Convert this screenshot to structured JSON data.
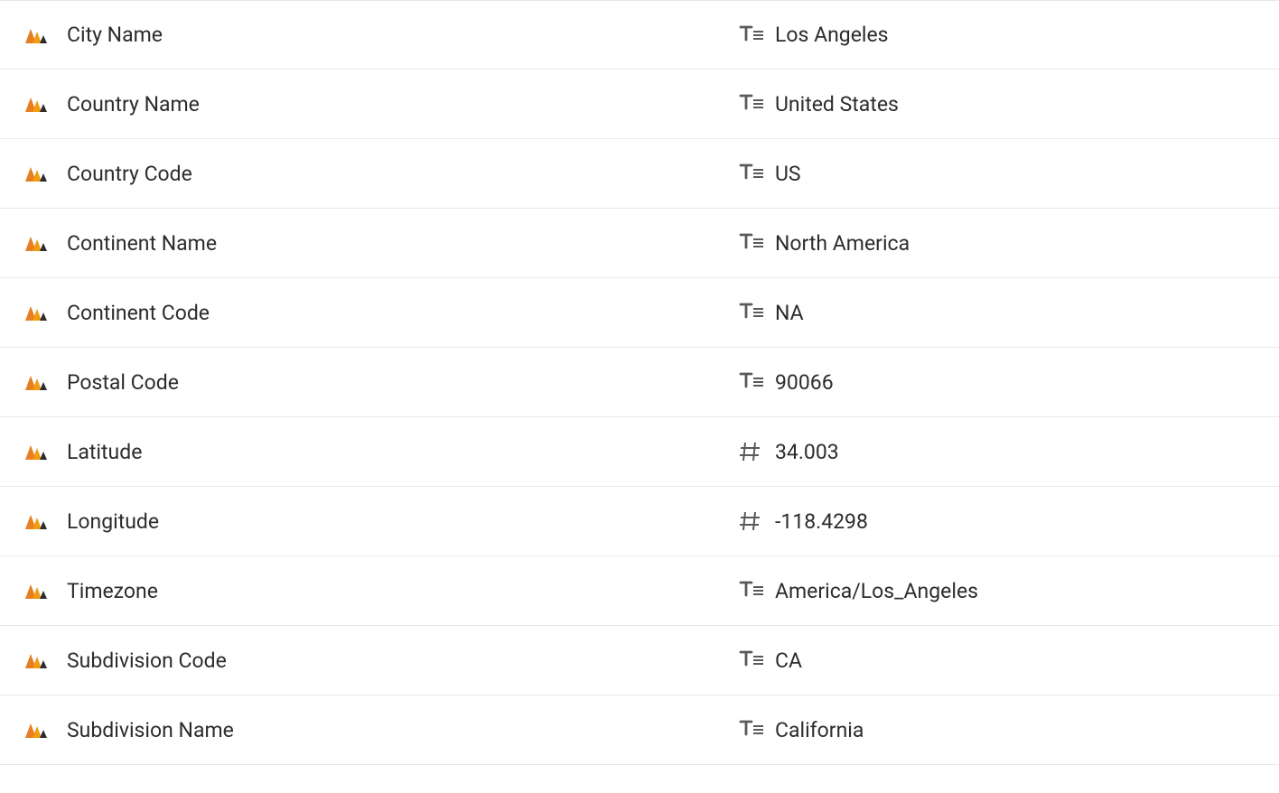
{
  "rows": [
    {
      "label": "City Name",
      "value": "Los Angeles",
      "type": "text"
    },
    {
      "label": "Country Name",
      "value": "United States",
      "type": "text"
    },
    {
      "label": "Country Code",
      "value": "US",
      "type": "text"
    },
    {
      "label": "Continent Name",
      "value": "North America",
      "type": "text"
    },
    {
      "label": "Continent Code",
      "value": "NA",
      "type": "text"
    },
    {
      "label": "Postal Code",
      "value": "90066",
      "type": "text"
    },
    {
      "label": "Latitude",
      "value": "34.003",
      "type": "number"
    },
    {
      "label": "Longitude",
      "value": "-118.4298",
      "type": "number"
    },
    {
      "label": "Timezone",
      "value": "America/Los_Angeles",
      "type": "text"
    },
    {
      "label": "Subdivision Code",
      "value": "CA",
      "type": "text"
    },
    {
      "label": "Subdivision Name",
      "value": "California",
      "type": "text"
    }
  ]
}
